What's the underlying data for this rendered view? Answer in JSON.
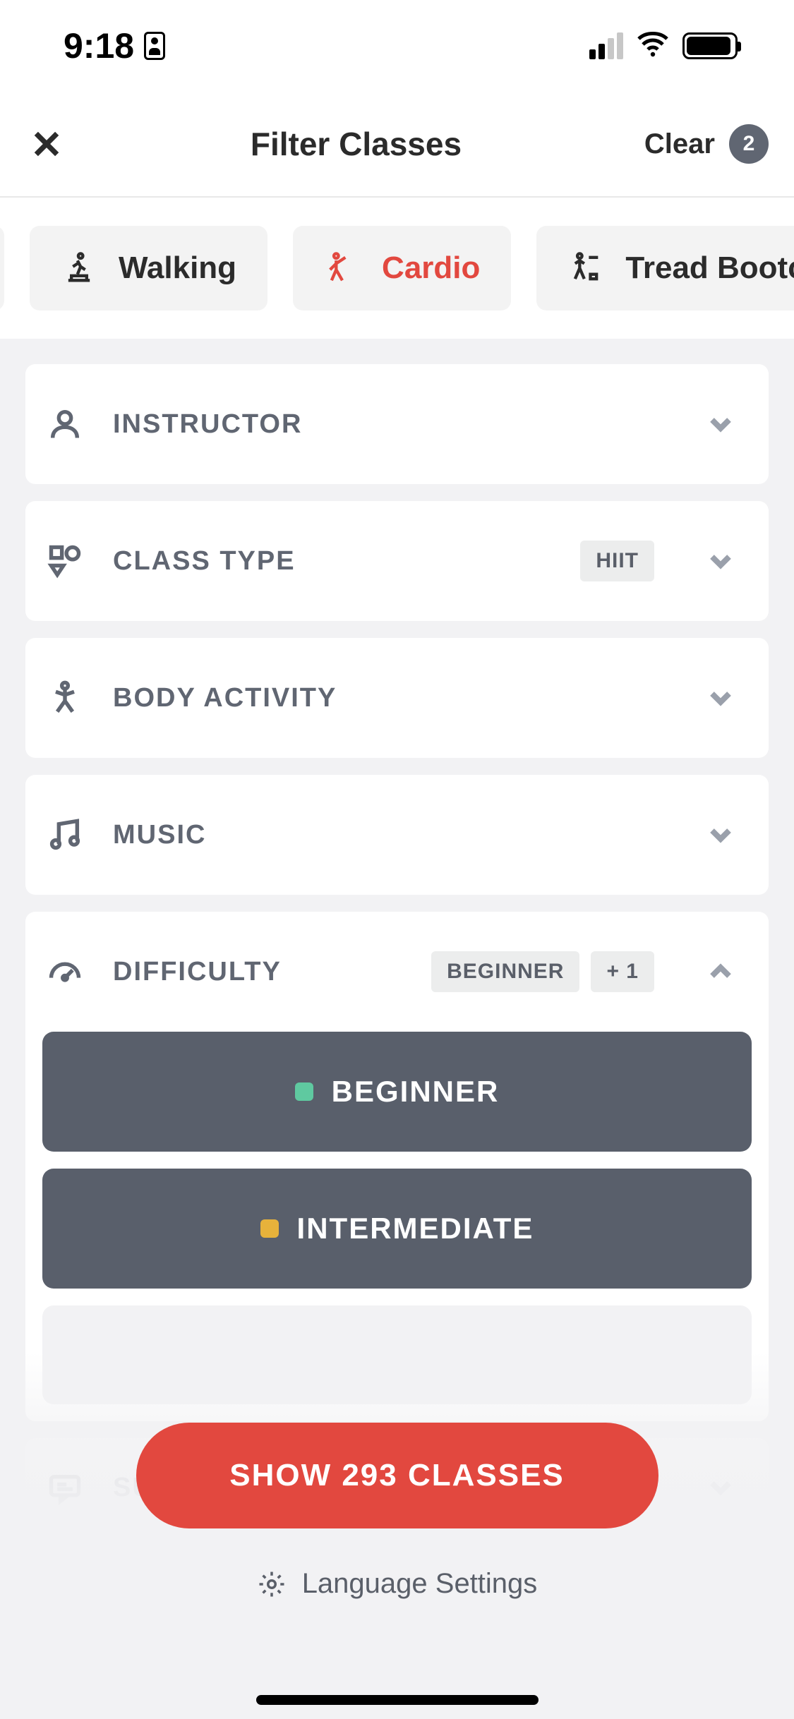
{
  "status": {
    "time": "9:18"
  },
  "header": {
    "title": "Filter Classes",
    "clear_label": "Clear",
    "badge_count": "2"
  },
  "categories": [
    {
      "label": "Walking",
      "icon": "walking-icon",
      "active": false
    },
    {
      "label": "Cardio",
      "icon": "cardio-icon",
      "active": true
    },
    {
      "label": "Tread Bootcamp",
      "icon": "bootcamp-icon",
      "active": false
    }
  ],
  "filters": {
    "instructor": {
      "label": "INSTRUCTOR"
    },
    "class_type": {
      "label": "CLASS TYPE",
      "tag": "HIIT"
    },
    "body_activity": {
      "label": "BODY ACTIVITY"
    },
    "music": {
      "label": "MUSIC"
    },
    "difficulty": {
      "label": "DIFFICULTY",
      "tags": [
        "BEGINNER",
        "+ 1"
      ],
      "options": [
        {
          "label": "BEGINNER",
          "color": "green",
          "selected": true
        },
        {
          "label": "INTERMEDIATE",
          "color": "yellow",
          "selected": true
        }
      ]
    },
    "subtitles": {
      "label": "SUBTITLES"
    }
  },
  "footer": {
    "show_button": "SHOW 293 CLASSES",
    "language_settings": "Language Settings"
  }
}
